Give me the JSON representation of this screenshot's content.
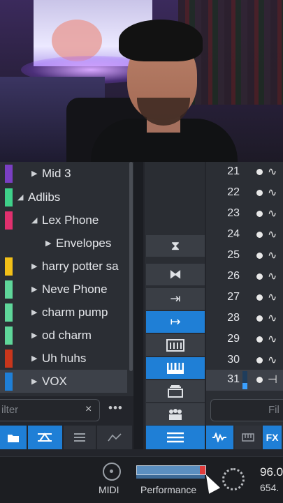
{
  "tracks": [
    {
      "label": "Mid 3",
      "color": "#7a3fc2",
      "selected": false
    },
    {
      "label": "Adlibs",
      "color": "#3fd08a",
      "selected": false
    },
    {
      "label": "Lex Phone",
      "color": "#e0306e",
      "selected": false
    },
    {
      "label": "Envelopes",
      "color": "",
      "selected": false
    },
    {
      "label": "harry potter sa",
      "color": "#f2c018",
      "selected": false
    },
    {
      "label": "Neve Phone",
      "color": "#5fd69a",
      "selected": false
    },
    {
      "label": "charm pump",
      "color": "#5fd69a",
      "selected": false
    },
    {
      "label": "od charm",
      "color": "#5fd69a",
      "selected": false
    },
    {
      "label": "Uh huhs",
      "color": "#c8361c",
      "selected": false
    },
    {
      "label": "VOX",
      "color": "#1f7fd6",
      "selected": true
    }
  ],
  "left_filter": {
    "placeholder": "ilter",
    "clear": "×"
  },
  "left_more": "•••",
  "channels": [
    {
      "number": "21",
      "selected": false
    },
    {
      "number": "22",
      "selected": false
    },
    {
      "number": "23",
      "selected": false
    },
    {
      "number": "24",
      "selected": false
    },
    {
      "number": "25",
      "selected": false
    },
    {
      "number": "26",
      "selected": false
    },
    {
      "number": "27",
      "selected": false
    },
    {
      "number": "28",
      "selected": false
    },
    {
      "number": "29",
      "selected": false
    },
    {
      "number": "30",
      "selected": false
    },
    {
      "number": "31",
      "selected": true
    }
  ],
  "right_filter": {
    "placeholder": "Fil"
  },
  "right_buttons": {
    "fx_label": "FX"
  },
  "status": {
    "midi_label": "MIDI",
    "performance_label": "Performance",
    "performance_level": 0.92,
    "tempo": "96.0",
    "position": "654."
  },
  "accent_color": "#1f7fd6"
}
